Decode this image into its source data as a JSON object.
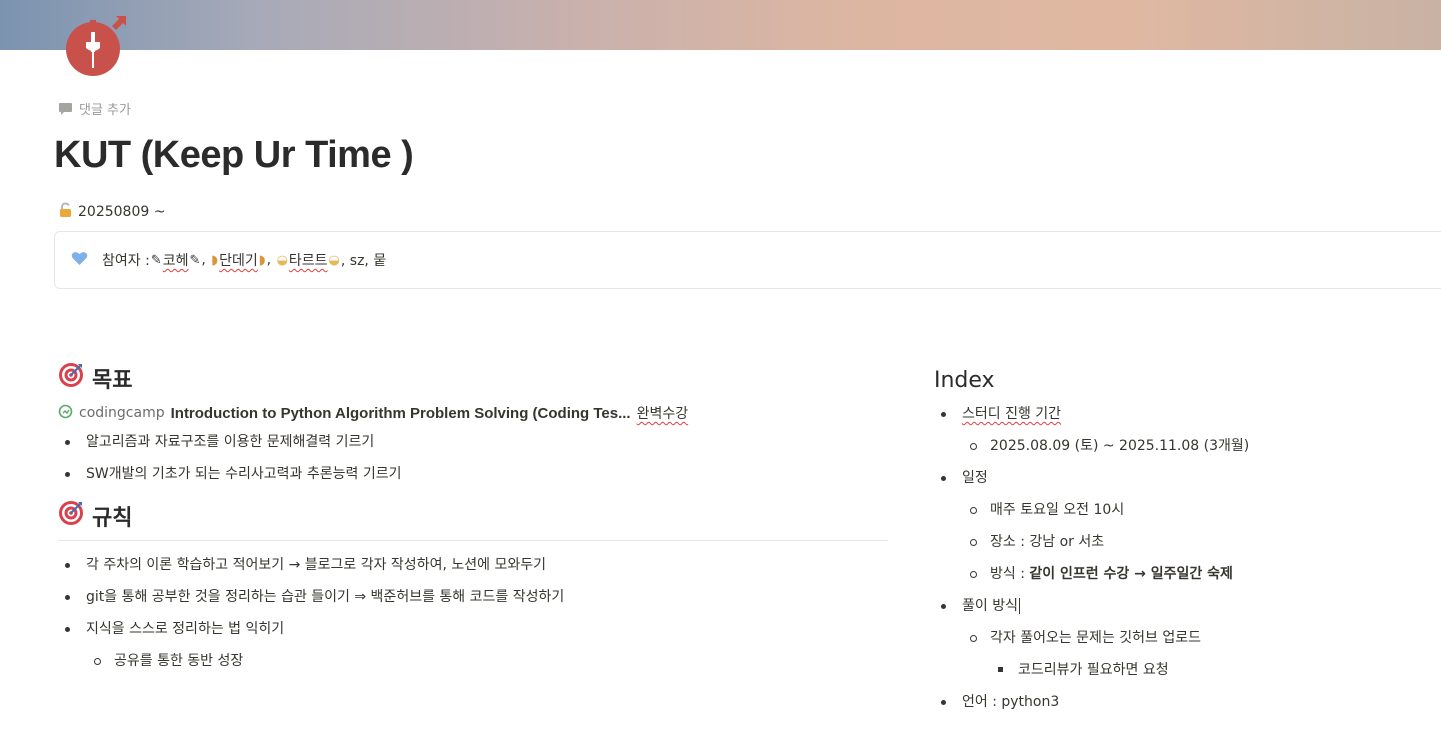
{
  "page": {
    "title": "KUT (Keep Ur Time )",
    "comment_label": "댓글 추가",
    "date_text": "20250809 ~"
  },
  "callout": {
    "prefix": "참여자 : ",
    "p1": "코헤",
    "p2": "단데기",
    "p3": "타르트",
    "rest": ", sz, 뭍"
  },
  "goal": {
    "heading": "목표",
    "link_source": "codingcamp",
    "link_title": "Introduction to Python Algorithm Problem Solving (Coding Tes...",
    "link_suffix": "완벽수강",
    "items": [
      "알고리즘과 자료구조를 이용한 문제해결력 기르기",
      "SW개발의 기초가 되는 수리사고력과 추론능력 기르기"
    ]
  },
  "rules": {
    "heading": "규칙",
    "items": [
      "각 주차의 이론 학습하고 적어보기 → 블로그로 각자 작성하여, 노션에 모와두기",
      "git을 통해 공부한 것을 정리하는 습관 들이기 ⇒ 백준허브를 통해 코드를 작성하기",
      "지식을 스스로 정리하는 법 익히기"
    ],
    "sub_item": "공유를 통한 동반 성장"
  },
  "index": {
    "heading": "Index",
    "period_label": "스터디 진행 기간",
    "period_value": "2025.08.09 (토) ~ 2025.11.08 (3개월)",
    "schedule_label": "일정",
    "schedule_time": "매주 토요일 오전 10시",
    "schedule_place": "장소 : 강남 or 서초",
    "schedule_method_prefix": "방식 : ",
    "schedule_method": "같이 인프런 수강 → 일주일간 숙제",
    "solve_label": "풀이 방식",
    "solve_item": "각자 풀어오는 문제는 깃허브 업로드",
    "solve_sub": "코드리뷰가 필요하면 요청",
    "language": "언어 : python3"
  },
  "colors": {
    "icon_red": "#c9514b",
    "accent_red": "#e03e3e",
    "heart_blue": "#7fb0e8"
  },
  "icons": [
    "stopwatch-icon",
    "comment-icon",
    "lock-icon",
    "heart-icon",
    "target-icon",
    "link-icon",
    "pen-emoji",
    "croissant-emoji",
    "cupcake-emoji"
  ]
}
